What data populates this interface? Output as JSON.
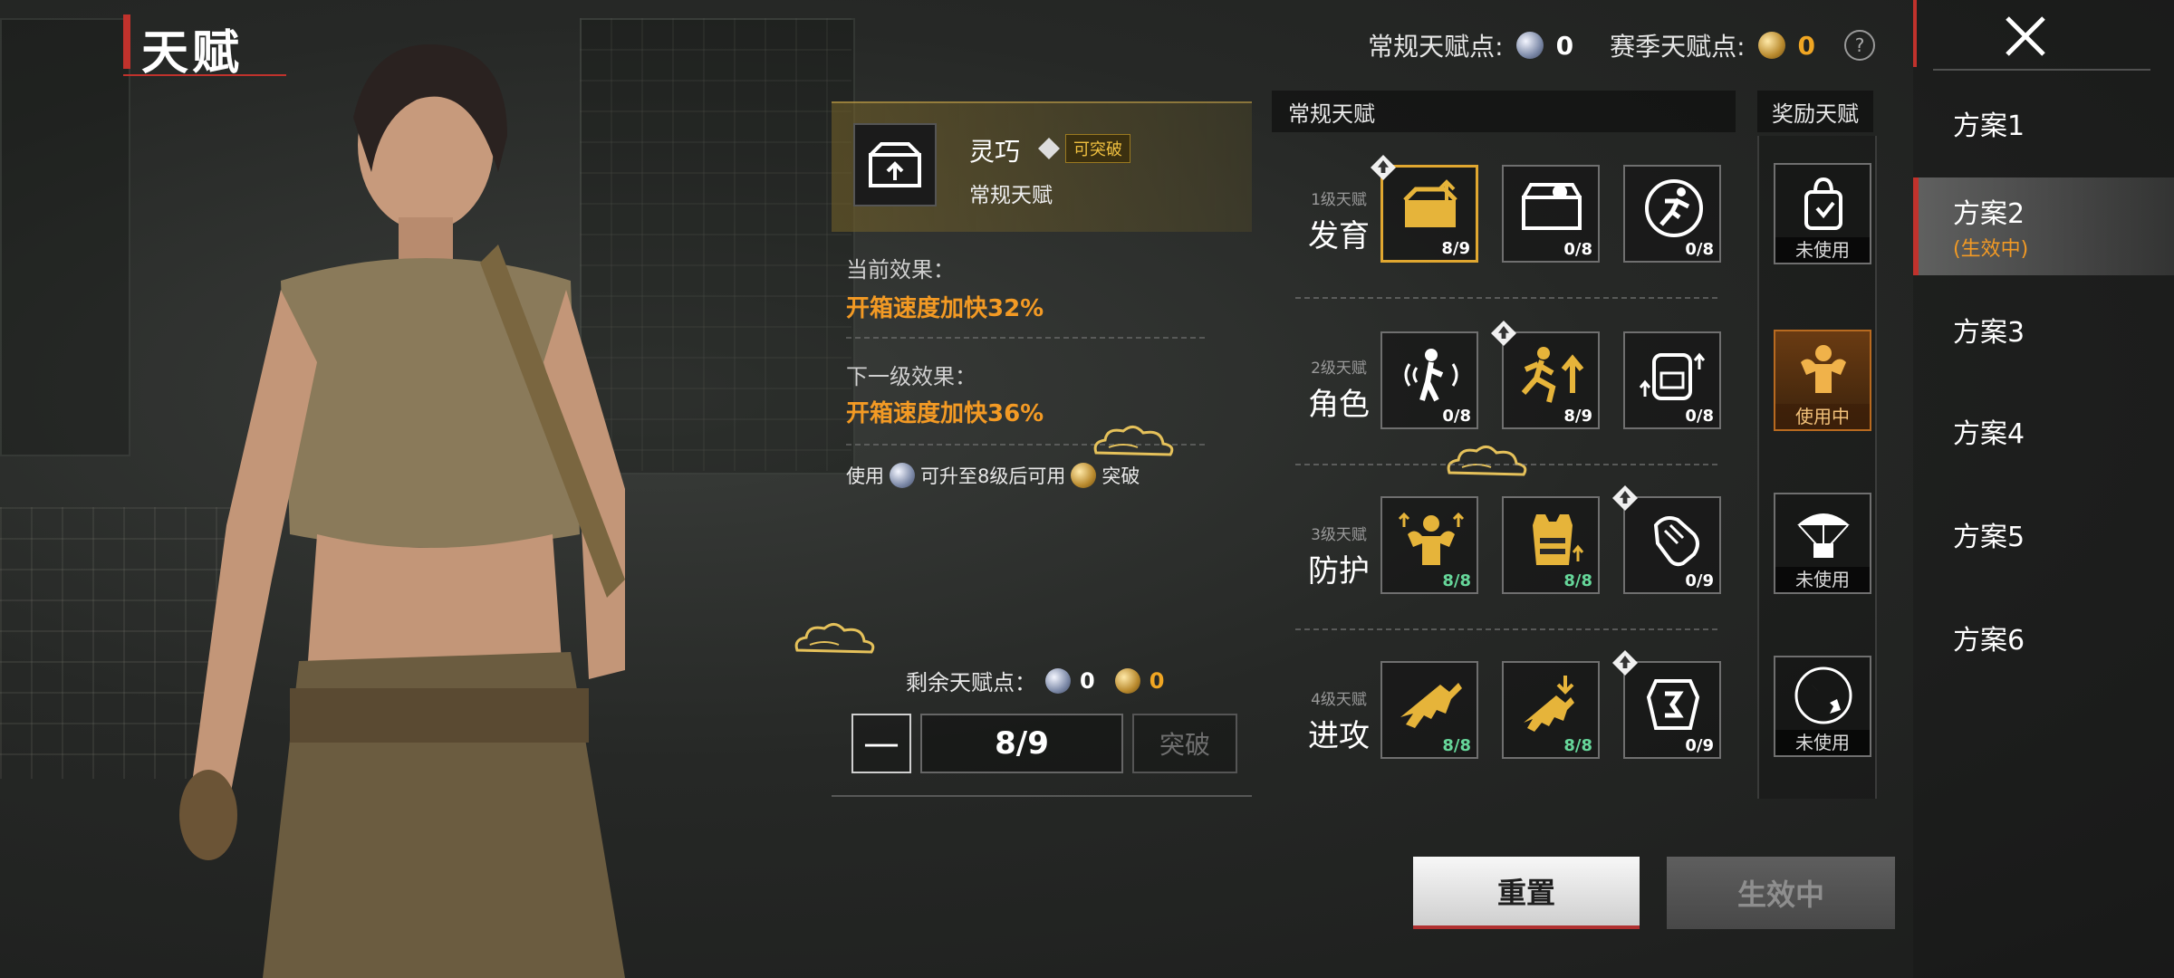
{
  "header": {
    "title": "天赋"
  },
  "points": {
    "regular_label": "常规天赋点:",
    "regular_value": "0",
    "season_label": "赛季天赋点:",
    "season_value": "0",
    "help": "?"
  },
  "detail": {
    "name": "灵巧",
    "breakable_tag": "可突破",
    "type": "常规天赋",
    "current_label": "当前效果：",
    "current_value": "开箱速度加快32%",
    "next_label": "下一级效果：",
    "next_value": "开箱速度加快36%",
    "hint_use": "使用",
    "hint_middle": "可升至8级后可用",
    "hint_end": "突破",
    "remaining_label": "剩余天赋点：",
    "remaining_regular": "0",
    "remaining_season": "0",
    "minus": "—",
    "level": "8/9",
    "break_button": "突破"
  },
  "tree": {
    "header": "常规天赋",
    "bonus_header": "奖励天赋",
    "rows": [
      {
        "level": "1级天赋",
        "name": "发育",
        "nodes": [
          "8/9",
          "0/8",
          "0/8"
        ],
        "bonus_state": "未使用"
      },
      {
        "level": "2级天赋",
        "name": "角色",
        "nodes": [
          "0/8",
          "8/9",
          "0/8"
        ],
        "bonus_state": "使用中"
      },
      {
        "level": "3级天赋",
        "name": "防护",
        "nodes": [
          "8/8",
          "8/8",
          "0/9"
        ],
        "bonus_state": "未使用"
      },
      {
        "level": "4级天赋",
        "name": "进攻",
        "nodes": [
          "8/8",
          "8/8",
          "0/9"
        ],
        "bonus_state": "未使用"
      }
    ]
  },
  "actions": {
    "reset": "重置",
    "active": "生效中"
  },
  "plans": [
    {
      "label": "方案1",
      "sub": ""
    },
    {
      "label": "方案2",
      "sub": "(生效中)"
    },
    {
      "label": "方案3",
      "sub": ""
    },
    {
      "label": "方案4",
      "sub": ""
    },
    {
      "label": "方案5",
      "sub": ""
    },
    {
      "label": "方案6",
      "sub": ""
    }
  ],
  "colors": {
    "accent_red": "#c0322c",
    "orange": "#f39a24",
    "gold": "#e0a730",
    "green_count": "#66d79a"
  }
}
